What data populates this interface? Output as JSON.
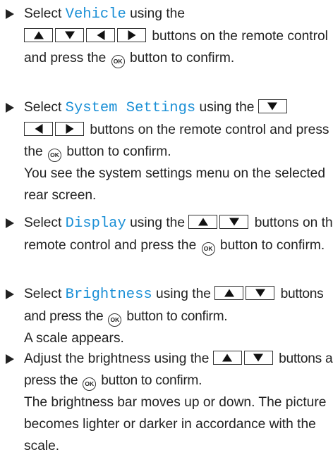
{
  "steps": [
    {
      "menu": "Vehicle",
      "pre": "Select ",
      "mid": " using the",
      "keys": [
        "up",
        "down",
        "left",
        "right"
      ],
      "after_keys": " buttons on the remote control and press the ",
      "ok": "OK",
      "end": " button to confirm.",
      "note": ""
    },
    {
      "menu": "System Settings",
      "pre": "Select ",
      "mid": " using the",
      "keys": [
        "down",
        "left",
        "right"
      ],
      "after_keys": " buttons on the remote control and press the ",
      "ok": "OK",
      "end": " button to confirm.",
      "note": "You see the system settings menu on the selected rear screen."
    },
    {
      "menu": "Display",
      "pre": "Select ",
      "mid": " using the",
      "keys": [
        "up",
        "down"
      ],
      "after_keys": " buttons on the remote control and press the ",
      "ok": "OK",
      "end": " button to confirm.",
      "note": ""
    },
    {
      "menu": "Brightness",
      "pre": "Select ",
      "mid": " using the",
      "keys": [
        "up",
        "down"
      ],
      "after_keys": " buttons and press the ",
      "ok": "OK",
      "end": " button to confirm.",
      "note": "A scale appears."
    },
    {
      "menu": "",
      "pre": "Adjust the brightness using the",
      "mid": "",
      "keys": [
        "up",
        "down"
      ],
      "after_keys": " buttons and press the ",
      "ok": "OK",
      "end": " button to confirm.",
      "note": "The brightness bar moves up or down. The picture becomes lighter or darker in accordance with the scale."
    }
  ]
}
